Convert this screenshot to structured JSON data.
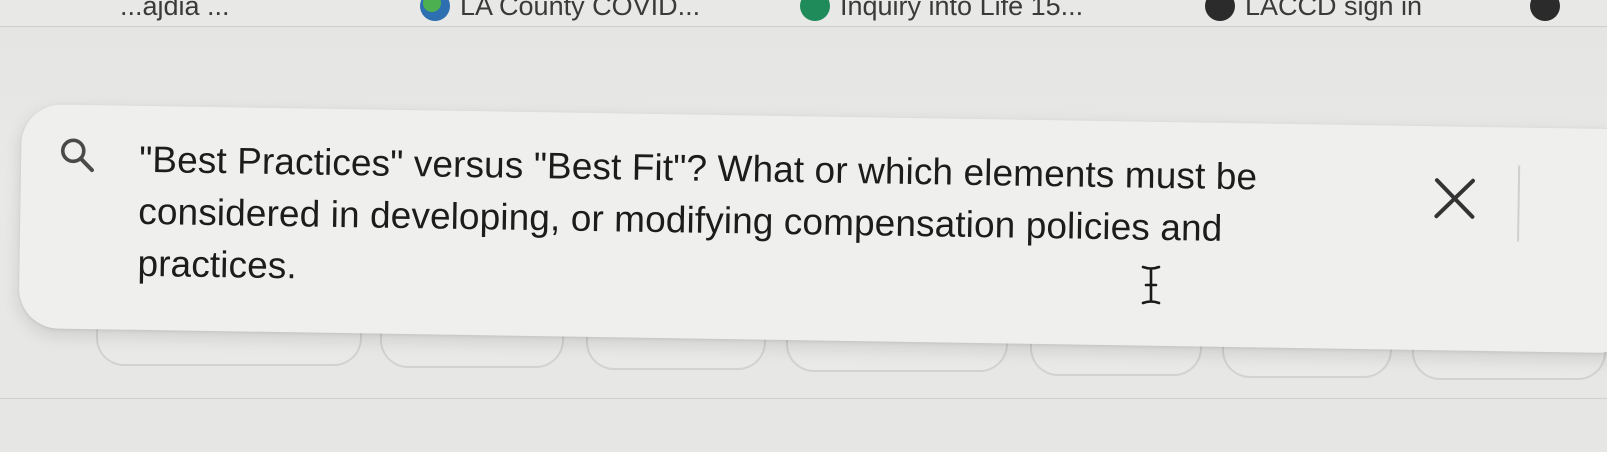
{
  "bookmarks": [
    {
      "label": "...ajdia ...",
      "icon": "bookmark-icon"
    },
    {
      "label": "LA County COVID...",
      "icon": "globe-icon"
    },
    {
      "label": "Inquiry into Life 15...",
      "icon": "green-circle-icon"
    },
    {
      "label": "LACCD sign in",
      "icon": "dark-circle-icon"
    }
  ],
  "search": {
    "query": "\"Best Practices\" versus \"Best Fit\"? What or which elements must be considered in developing, or modifying compensation policies and practices.",
    "icon": "search-icon",
    "clear_icon": "close-icon"
  },
  "colors": {
    "background": "#e6e6e4",
    "search_box": "#efefed",
    "text": "#1c1c1c",
    "icon": "#4a4a4a"
  }
}
